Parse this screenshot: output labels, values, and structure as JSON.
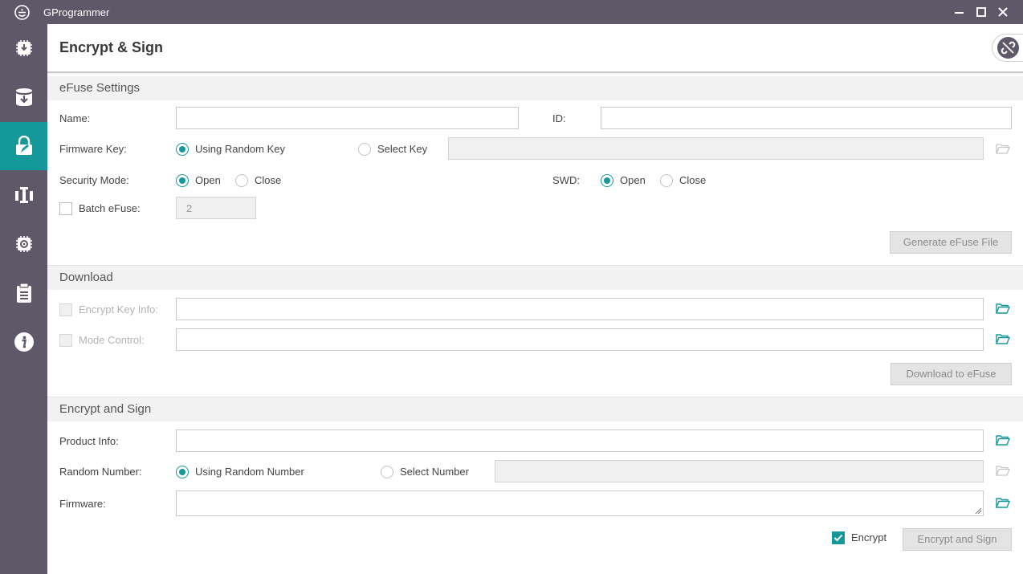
{
  "app": {
    "title": "GProgrammer"
  },
  "sidebar": {
    "items": [
      {
        "icon": "chip-download-icon"
      },
      {
        "icon": "database-download-icon"
      },
      {
        "icon": "lock-pen-icon",
        "active": true
      },
      {
        "icon": "tools-icon"
      },
      {
        "icon": "chip-settings-icon"
      },
      {
        "icon": "clipboard-icon"
      },
      {
        "icon": "info-icon"
      }
    ]
  },
  "header": {
    "title": "Encrypt & Sign"
  },
  "efuse": {
    "section_title": "eFuse Settings",
    "name_label": "Name:",
    "name_value": "",
    "id_label": "ID:",
    "id_value": "",
    "firmware_key_label": "Firmware Key:",
    "random_key_label": "Using Random Key",
    "select_key_label": "Select Key",
    "select_key_value": "",
    "security_mode_label": "Security Mode:",
    "open_label": "Open",
    "close_label": "Close",
    "swd_label": "SWD:",
    "swd_open_label": "Open",
    "swd_close_label": "Close",
    "batch_label": "Batch eFuse:",
    "batch_value": "2",
    "generate_button": "Generate eFuse File"
  },
  "download": {
    "section_title": "Download",
    "encrypt_key_label": "Encrypt Key Info:",
    "encrypt_key_value": "",
    "mode_control_label": "Mode Control:",
    "mode_control_value": "",
    "download_button": "Download to eFuse"
  },
  "encrypt": {
    "section_title": "Encrypt and Sign",
    "product_info_label": "Product Info:",
    "product_info_value": "",
    "random_number_label": "Random Number:",
    "using_random_label": "Using Random Number",
    "select_number_label": "Select Number",
    "select_number_value": "",
    "firmware_label": "Firmware:",
    "firmware_value": "",
    "encrypt_check_label": "Encrypt",
    "encrypt_checked": true,
    "encrypt_button": "Encrypt and Sign"
  },
  "colors": {
    "sidebar": "#5e5869",
    "accent": "#14989a"
  }
}
